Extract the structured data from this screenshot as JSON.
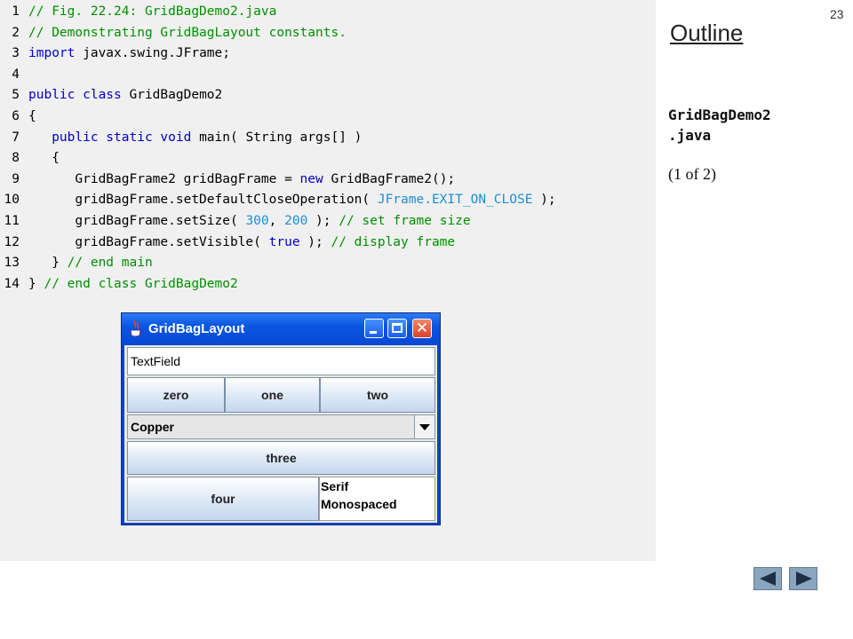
{
  "slide": {
    "page_number": "23",
    "outline_title": "Outline",
    "file_name_line1": "GridBagDemo2",
    "file_name_line2": ".java",
    "part": "(1 of 2)"
  },
  "code": {
    "lines": [
      {
        "n": "1",
        "tokens": [
          [
            "cm",
            "// Fig. 22.24: GridBagDemo2.java"
          ]
        ]
      },
      {
        "n": "2",
        "tokens": [
          [
            "cm",
            "// Demonstrating GridBagLayout constants."
          ]
        ]
      },
      {
        "n": "3",
        "tokens": [
          [
            "kw",
            "import"
          ],
          [
            "pl",
            " javax.swing.JFrame;"
          ]
        ]
      },
      {
        "n": "4",
        "tokens": []
      },
      {
        "n": "5",
        "tokens": [
          [
            "kw",
            "public class"
          ],
          [
            "pl",
            " GridBagDemo2"
          ]
        ]
      },
      {
        "n": "6",
        "tokens": [
          [
            "pl",
            "{"
          ]
        ]
      },
      {
        "n": "7",
        "tokens": [
          [
            "pl",
            "   "
          ],
          [
            "kw",
            "public static void"
          ],
          [
            "pl",
            " main( String args[] )"
          ]
        ]
      },
      {
        "n": "8",
        "tokens": [
          [
            "pl",
            "   {"
          ]
        ]
      },
      {
        "n": "9",
        "tokens": [
          [
            "pl",
            "      GridBagFrame2 gridBagFrame = "
          ],
          [
            "kw",
            "new"
          ],
          [
            "pl",
            " GridBagFrame2();"
          ]
        ]
      },
      {
        "n": "10",
        "tokens": [
          [
            "pl",
            "      gridBagFrame.setDefaultCloseOperation( "
          ],
          [
            "cs",
            "JFrame.EXIT_ON_CLOSE"
          ],
          [
            "pl",
            " );"
          ]
        ]
      },
      {
        "n": "11",
        "tokens": [
          [
            "pl",
            "      gridBagFrame.setSize( "
          ],
          [
            "cs",
            "300"
          ],
          [
            "pl",
            ", "
          ],
          [
            "cs",
            "200"
          ],
          [
            "pl",
            " ); "
          ],
          [
            "cm",
            "// set frame size"
          ]
        ]
      },
      {
        "n": "12",
        "tokens": [
          [
            "pl",
            "      gridBagFrame.setVisible( "
          ],
          [
            "kw",
            "true"
          ],
          [
            "pl",
            " ); "
          ],
          [
            "cm",
            "// display frame"
          ]
        ]
      },
      {
        "n": "13",
        "tokens": [
          [
            "pl",
            "   } "
          ],
          [
            "cm",
            "// end main"
          ]
        ]
      },
      {
        "n": "14",
        "tokens": [
          [
            "pl",
            "} "
          ],
          [
            "cm",
            "// end class GridBagDemo2"
          ]
        ]
      }
    ]
  },
  "window": {
    "title": "GridBagLayout",
    "textfield_value": "TextField",
    "buttons": {
      "zero": "zero",
      "one": "one",
      "two": "two",
      "three": "three",
      "four": "four"
    },
    "combo_selected": "Copper",
    "font_list": [
      "Serif",
      "Monospaced"
    ]
  },
  "icons": {
    "window_icon": "java-cup-icon",
    "prev": "arrow-left-icon",
    "next": "arrow-right-icon"
  },
  "colors": {
    "keyword": "#0000cc",
    "comment": "#009000",
    "constant": "#1a8fd6",
    "titlebar": "#0a55e0",
    "nav_button": "#8aa6bf"
  }
}
